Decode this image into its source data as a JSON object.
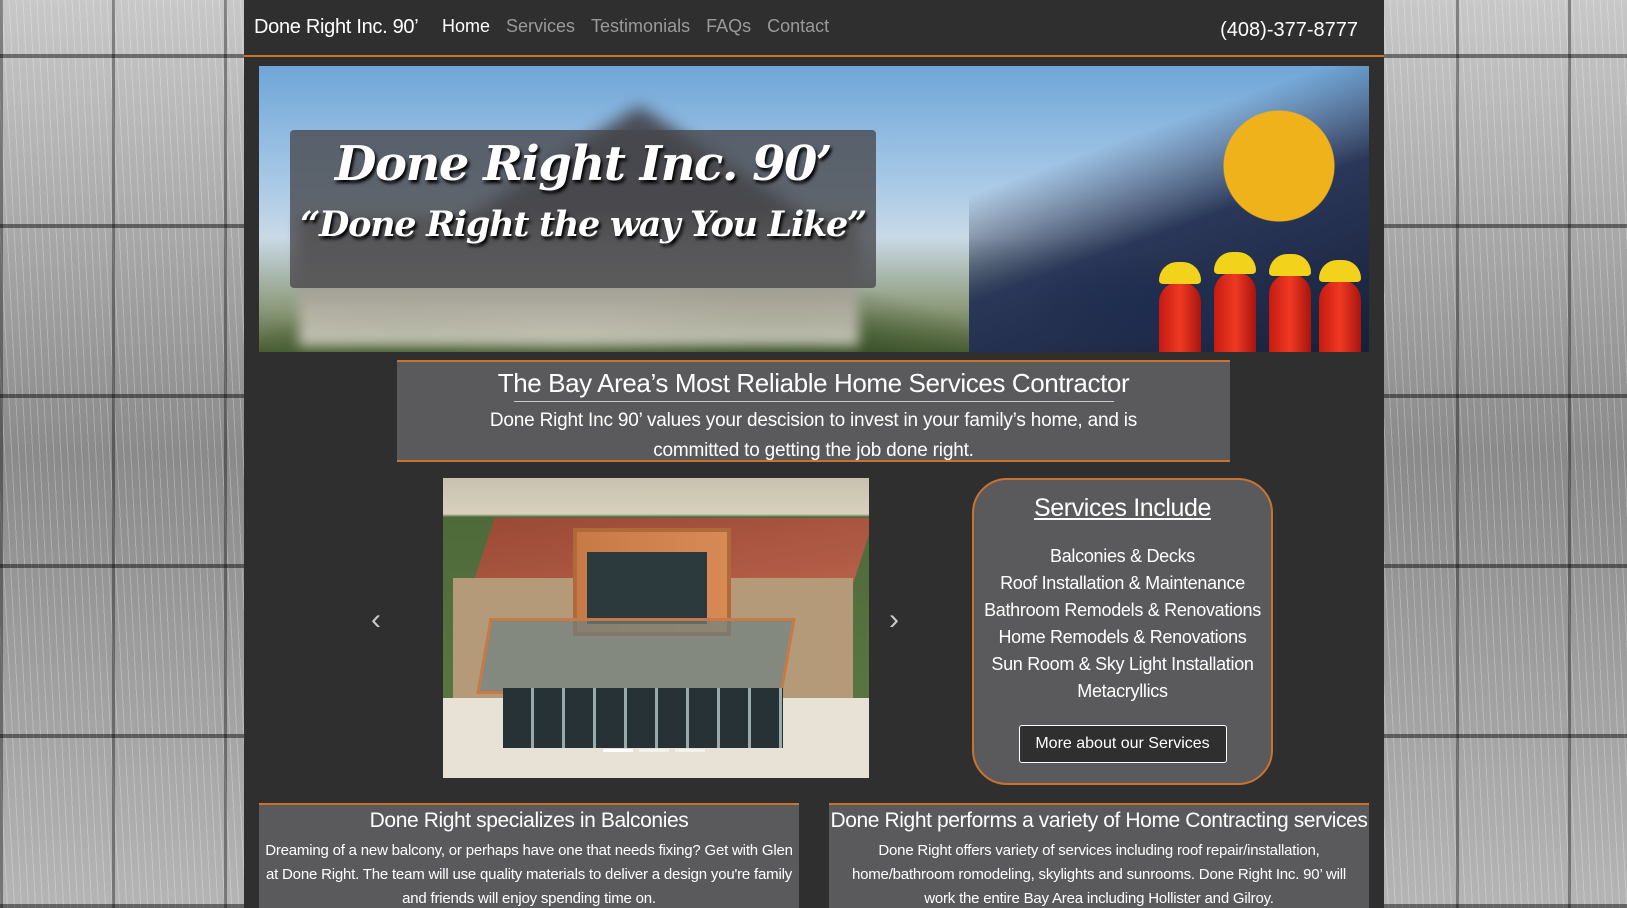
{
  "navbar": {
    "brand": "Done Right Inc. 90’",
    "links": [
      "Home",
      "Services",
      "Testimonials",
      "FAQs",
      "Contact"
    ],
    "active_link": "Home",
    "phone": "(408)-377-8777"
  },
  "hero": {
    "title": "Done Right Inc. 90’",
    "slogan": "“Done Right the way You Like”"
  },
  "intro": {
    "title": "The Bay Area’s Most Reliable Home Services Contractor",
    "text": "Done Right Inc 90’ values your descision to invest in your family’s home, and is committed to getting the job done right."
  },
  "carousel": {
    "prev_icon": "chevron-left-icon",
    "next_icon": "chevron-right-icon",
    "slide_count": 3,
    "active_slide": 1
  },
  "services": {
    "title": "Services Include",
    "items": [
      "Balconies & Decks",
      "Roof Installation & Maintenance",
      "Bathroom Remodels & Renovations",
      "Home Remodels & Renovations",
      "Sun Room & Sky Light Installation",
      "Metacryllics"
    ],
    "button": "More about our Services"
  },
  "panels": [
    {
      "title": "Done Right specializes in Balconies",
      "text": "Dreaming of a new balcony, or perhaps have one that needs fixing? Get with Glen at Done Right. The team will use quality materials to deliver a design you're family and friends will enjoy spending time on."
    },
    {
      "title": "Done Right performs a variety of Home Contracting services",
      "text": "Done Right offers variety of services including roof repair/installation, home/bathroom romodeling, skylights and sunrooms. Done Right Inc. 90’ will work the entire Bay Area including Hollister and Gilroy."
    }
  ],
  "colors": {
    "accent": "#c8742f",
    "page_bg": "#2f2f30",
    "panel_bg": "#5a5a5c"
  }
}
